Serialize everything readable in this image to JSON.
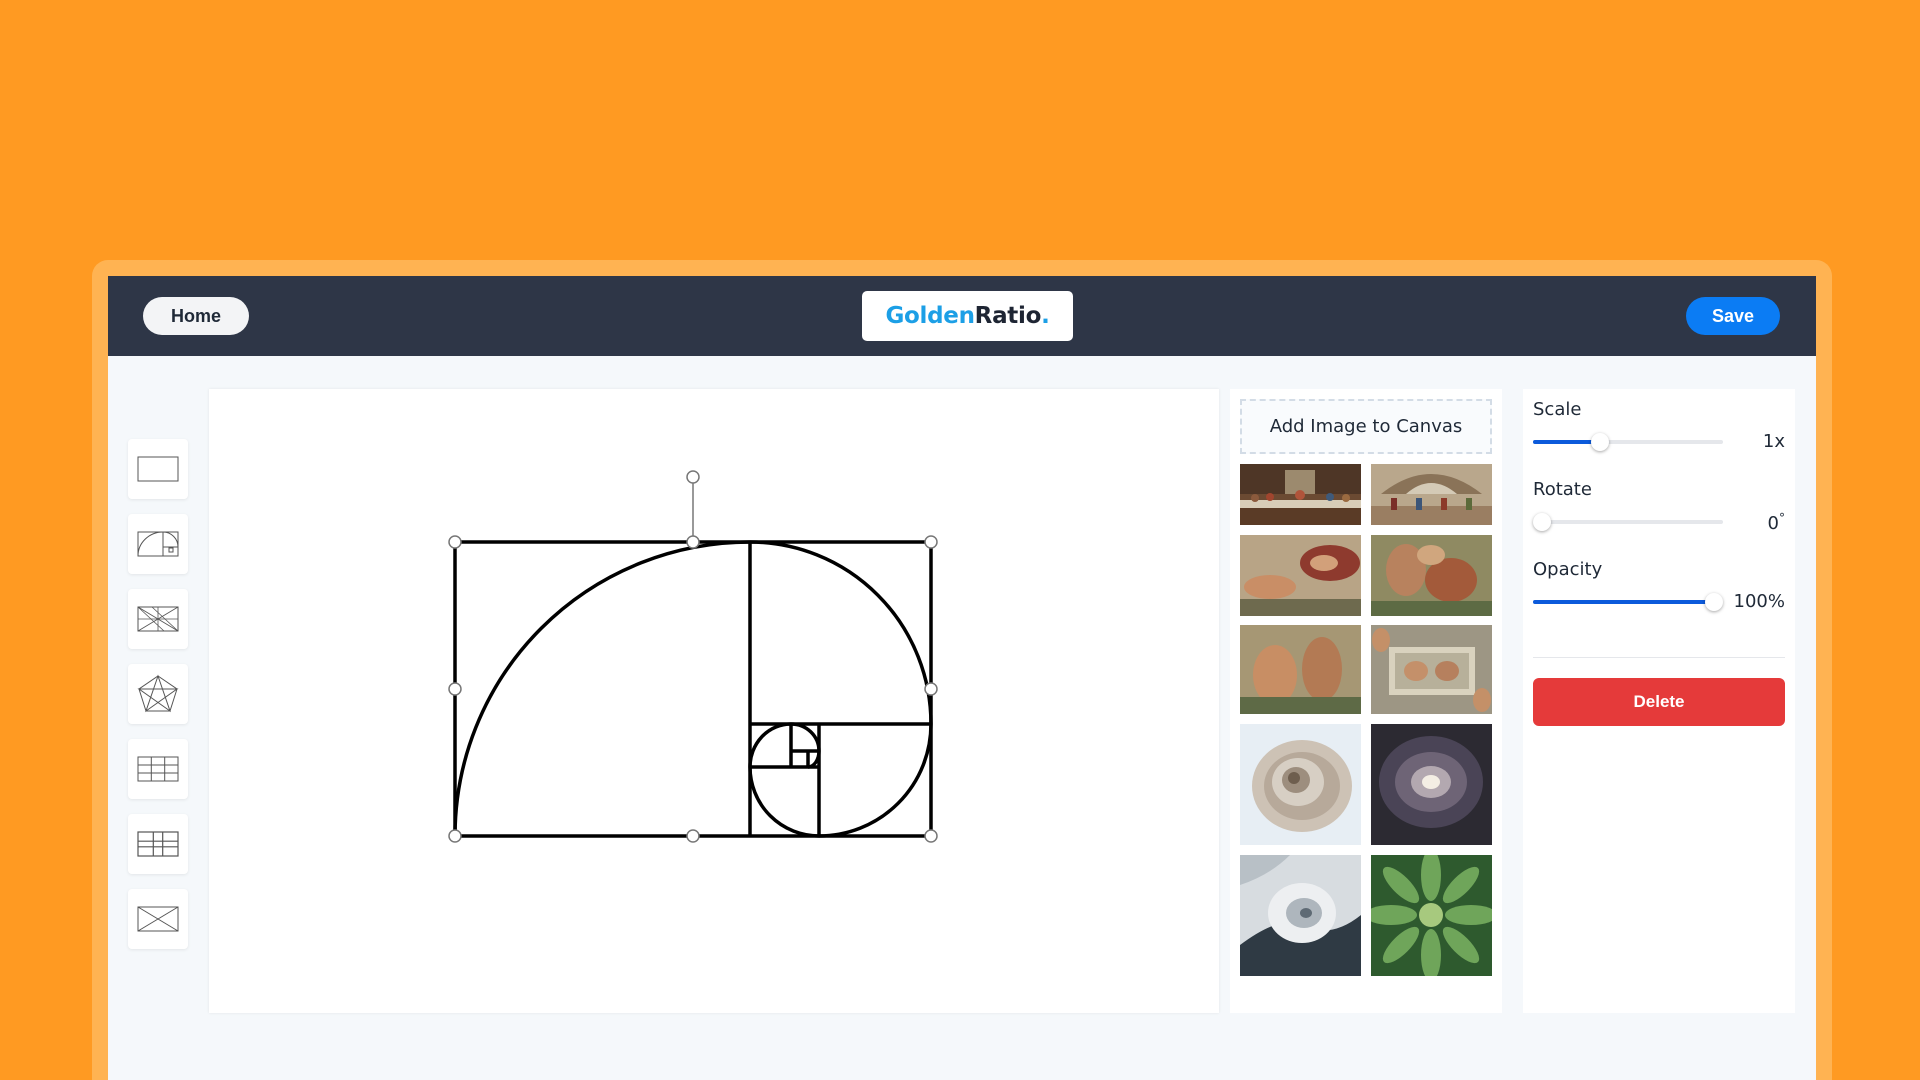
{
  "header": {
    "home_label": "Home",
    "logo_part1": "Golden",
    "logo_part2": "Ratio",
    "logo_dot": ".",
    "save_label": "Save"
  },
  "tools": [
    {
      "icon": "rectangle-frame-icon"
    },
    {
      "icon": "golden-spiral-icon"
    },
    {
      "icon": "harmonic-grid-icon"
    },
    {
      "icon": "pentagram-icon"
    },
    {
      "icon": "thirds-grid-icon"
    },
    {
      "icon": "phi-grid-icon"
    },
    {
      "icon": "diagonal-cross-icon"
    }
  ],
  "gallery": {
    "add_label": "Add Image to Canvas",
    "images": [
      "last-supper-thumbnail",
      "school-of-athens-thumbnail",
      "creation-of-adam-thumbnail",
      "fresco-battle-thumbnail",
      "fresco-figures-thumbnail",
      "sistine-panel-thumbnail",
      "nautilus-shell-thumbnail",
      "spiral-galaxy-thumbnail",
      "hurricane-thumbnail",
      "succulent-plant-thumbnail"
    ]
  },
  "properties": {
    "scale": {
      "label": "Scale",
      "value": "1x",
      "level": 0.35
    },
    "rotate": {
      "label": "Rotate",
      "value": "0",
      "unit": "°",
      "level": 0.0
    },
    "opacity": {
      "label": "Opacity",
      "value": "100%",
      "level": 0.95
    },
    "delete_label": "Delete"
  },
  "colors": {
    "background": "#FF9A22",
    "topbar": "#2E3647",
    "save_button": "#0B7CF4",
    "delete_button": "#E53A3A",
    "slider_fill": "#0C5ADB",
    "logo_blue": "#1C9FE6"
  }
}
